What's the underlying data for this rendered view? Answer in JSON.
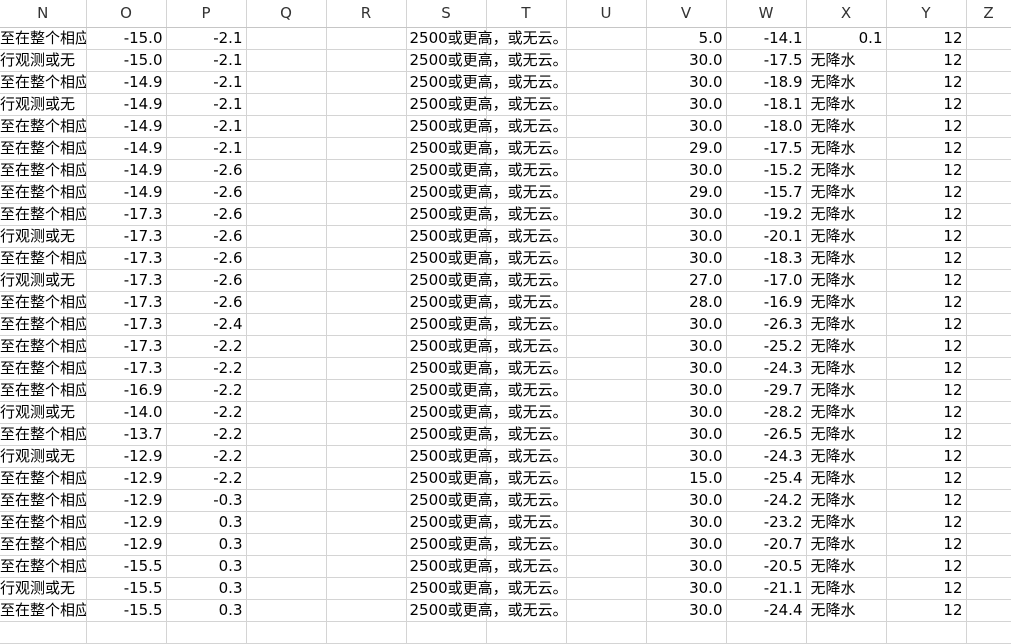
{
  "columns": [
    "N",
    "O",
    "P",
    "Q",
    "R",
    "S",
    "T",
    "U",
    "V",
    "W",
    "X",
    "Y",
    "Z"
  ],
  "rows": [
    {
      "N": "至在整个相应",
      "O": "-15.0",
      "P": "-2.1",
      "S": "2500或更高，或无云。",
      "V": "5.0",
      "W": "-14.1",
      "X": "0.1",
      "Y": "12"
    },
    {
      "N": "行观测或无",
      "O": "-15.0",
      "P": "-2.1",
      "S": "2500或更高，或无云。",
      "V": "30.0",
      "W": "-17.5",
      "X": "无降水",
      "Y": "12"
    },
    {
      "N": "至在整个相应",
      "O": "-14.9",
      "P": "-2.1",
      "S": "2500或更高，或无云。",
      "V": "30.0",
      "W": "-18.9",
      "X": "无降水",
      "Y": "12"
    },
    {
      "N": "行观测或无",
      "O": "-14.9",
      "P": "-2.1",
      "S": "2500或更高，或无云。",
      "V": "30.0",
      "W": "-18.1",
      "X": "无降水",
      "Y": "12"
    },
    {
      "N": "至在整个相应",
      "O": "-14.9",
      "P": "-2.1",
      "S": "2500或更高，或无云。",
      "V": "30.0",
      "W": "-18.0",
      "X": "无降水",
      "Y": "12"
    },
    {
      "N": "至在整个相应",
      "O": "-14.9",
      "P": "-2.1",
      "S": "2500或更高，或无云。",
      "V": "29.0",
      "W": "-17.5",
      "X": "无降水",
      "Y": "12"
    },
    {
      "N": "至在整个相应",
      "O": "-14.9",
      "P": "-2.6",
      "S": "2500或更高，或无云。",
      "V": "30.0",
      "W": "-15.2",
      "X": "无降水",
      "Y": "12"
    },
    {
      "N": "至在整个相应",
      "O": "-14.9",
      "P": "-2.6",
      "S": "2500或更高，或无云。",
      "V": "29.0",
      "W": "-15.7",
      "X": "无降水",
      "Y": "12"
    },
    {
      "N": "至在整个相应",
      "O": "-17.3",
      "P": "-2.6",
      "S": "2500或更高，或无云。",
      "V": "30.0",
      "W": "-19.2",
      "X": "无降水",
      "Y": "12"
    },
    {
      "N": "行观测或无",
      "O": "-17.3",
      "P": "-2.6",
      "S": "2500或更高，或无云。",
      "V": "30.0",
      "W": "-20.1",
      "X": "无降水",
      "Y": "12"
    },
    {
      "N": "至在整个相应",
      "O": "-17.3",
      "P": "-2.6",
      "S": "2500或更高，或无云。",
      "V": "30.0",
      "W": "-18.3",
      "X": "无降水",
      "Y": "12"
    },
    {
      "N": "行观测或无",
      "O": "-17.3",
      "P": "-2.6",
      "S": "2500或更高，或无云。",
      "V": "27.0",
      "W": "-17.0",
      "X": "无降水",
      "Y": "12"
    },
    {
      "N": "至在整个相应",
      "O": "-17.3",
      "P": "-2.6",
      "S": "2500或更高，或无云。",
      "V": "28.0",
      "W": "-16.9",
      "X": "无降水",
      "Y": "12"
    },
    {
      "N": "至在整个相应",
      "O": "-17.3",
      "P": "-2.4",
      "S": "2500或更高，或无云。",
      "V": "30.0",
      "W": "-26.3",
      "X": "无降水",
      "Y": "12"
    },
    {
      "N": "至在整个相应",
      "O": "-17.3",
      "P": "-2.2",
      "S": "2500或更高，或无云。",
      "V": "30.0",
      "W": "-25.2",
      "X": "无降水",
      "Y": "12"
    },
    {
      "N": "至在整个相应",
      "O": "-17.3",
      "P": "-2.2",
      "S": "2500或更高，或无云。",
      "V": "30.0",
      "W": "-24.3",
      "X": "无降水",
      "Y": "12"
    },
    {
      "N": "至在整个相应",
      "O": "-16.9",
      "P": "-2.2",
      "S": "2500或更高，或无云。",
      "V": "30.0",
      "W": "-29.7",
      "X": "无降水",
      "Y": "12"
    },
    {
      "N": "行观测或无",
      "O": "-14.0",
      "P": "-2.2",
      "S": "2500或更高，或无云。",
      "V": "30.0",
      "W": "-28.2",
      "X": "无降水",
      "Y": "12"
    },
    {
      "N": "至在整个相应",
      "O": "-13.7",
      "P": "-2.2",
      "S": "2500或更高，或无云。",
      "V": "30.0",
      "W": "-26.5",
      "X": "无降水",
      "Y": "12"
    },
    {
      "N": "行观测或无",
      "O": "-12.9",
      "P": "-2.2",
      "S": "2500或更高，或无云。",
      "V": "30.0",
      "W": "-24.3",
      "X": "无降水",
      "Y": "12"
    },
    {
      "N": "至在整个相应",
      "O": "-12.9",
      "P": "-2.2",
      "S": "2500或更高，或无云。",
      "V": "15.0",
      "W": "-25.4",
      "X": "无降水",
      "Y": "12"
    },
    {
      "N": "至在整个相应",
      "O": "-12.9",
      "P": "-0.3",
      "S": "2500或更高，或无云。",
      "V": "30.0",
      "W": "-24.2",
      "X": "无降水",
      "Y": "12"
    },
    {
      "N": "至在整个相应",
      "O": "-12.9",
      "P": "0.3",
      "S": "2500或更高，或无云。",
      "V": "30.0",
      "W": "-23.2",
      "X": "无降水",
      "Y": "12"
    },
    {
      "N": "至在整个相应",
      "O": "-12.9",
      "P": "0.3",
      "S": "2500或更高，或无云。",
      "V": "30.0",
      "W": "-20.7",
      "X": "无降水",
      "Y": "12"
    },
    {
      "N": "至在整个相应",
      "O": "-15.5",
      "P": "0.3",
      "S": "2500或更高，或无云。",
      "V": "30.0",
      "W": "-20.5",
      "X": "无降水",
      "Y": "12"
    },
    {
      "N": "行观测或无",
      "O": "-15.5",
      "P": "0.3",
      "S": "2500或更高，或无云。",
      "V": "30.0",
      "W": "-21.1",
      "X": "无降水",
      "Y": "12"
    },
    {
      "N": "至在整个相应",
      "O": "-15.5",
      "P": "0.3",
      "S": "2500或更高，或无云。",
      "V": "30.0",
      "W": "-24.4",
      "X": "无降水",
      "Y": "12"
    }
  ]
}
